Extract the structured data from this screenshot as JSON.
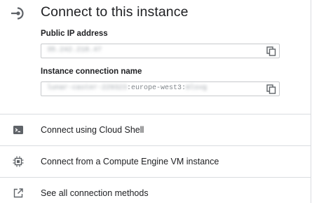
{
  "header": {
    "title": "Connect to this instance",
    "icon": "login-arrow-icon"
  },
  "fields": {
    "public_ip": {
      "label": "Public IP address",
      "value": "35.242.218.47",
      "copy_icon": "copy-icon"
    },
    "connection_name": {
      "label": "Instance connection name",
      "value_prefix": "lunar-caster-229323",
      "value_middle": ":europe-west3:",
      "value_suffix": "mlsvg",
      "copy_icon": "copy-icon"
    }
  },
  "actions": [
    {
      "label": "Connect using Cloud Shell",
      "icon": "terminal-icon"
    },
    {
      "label": "Connect from a Compute Engine VM instance",
      "icon": "chip-icon"
    },
    {
      "label": "See all connection methods",
      "icon": "open-in-new-icon"
    }
  ],
  "colors": {
    "text": "#202124",
    "icon": "#5f6368",
    "divider": "#dadce0",
    "field_border": "#c7c9cc"
  }
}
